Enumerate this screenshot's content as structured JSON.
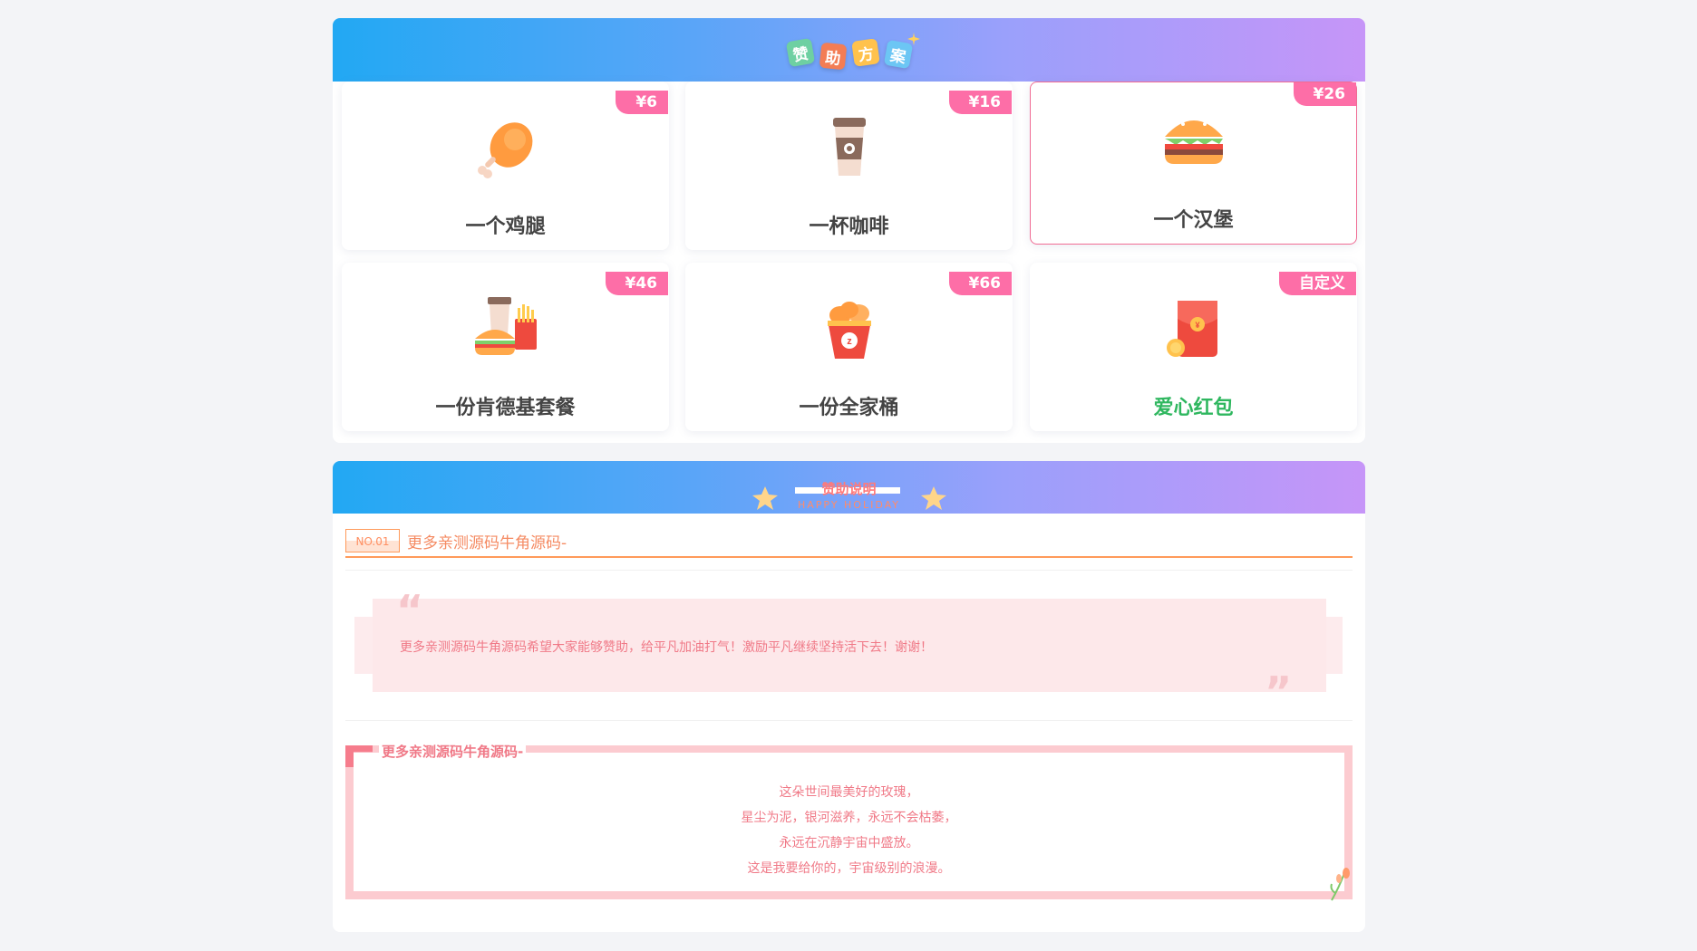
{
  "sponsor": {
    "title_chars": [
      "赞",
      "助",
      "方",
      "案"
    ],
    "options": [
      {
        "price": "¥6",
        "name": "一个鸡腿",
        "icon": "drumstick-icon"
      },
      {
        "price": "¥16",
        "name": "一杯咖啡",
        "icon": "coffee-cup-icon"
      },
      {
        "price": "¥26",
        "name": "一个汉堡",
        "icon": "burger-icon",
        "selected": true
      },
      {
        "price": "¥46",
        "name": "一份肯德基套餐",
        "icon": "combo-meal-icon"
      },
      {
        "price": "¥66",
        "name": "一份全家桶",
        "icon": "chicken-bucket-icon"
      },
      {
        "price": "自定义",
        "name": "爱心红包",
        "icon": "red-envelope-icon"
      }
    ]
  },
  "description": {
    "title": "赞助说明",
    "subtitle": "HAPPY HOLIDAY",
    "section_no": "NO.01",
    "section_title": "更多亲测源码牛角源码-",
    "quote_text": "更多亲测源码牛角源码希望大家能够赞助，给平凡加油打气！激励平凡继续坚持活下去！谢谢！",
    "poem_title": "更多亲测源码牛角源码-",
    "poem_lines": [
      "这朵世间最美好的玫瑰，",
      "星尘为泥，银河滋养，永远不会枯萎，",
      "永远在沉静宇宙中盛放。",
      "这是我要给你的，宇宙级别的浪漫。"
    ]
  },
  "colors": {
    "banner_start": "#22a8f3",
    "banner_end": "#c695f8",
    "price_tag": "#fd6ea7",
    "selected_border": "#f06c94",
    "accent_green": "#2fb75f",
    "accent_pink": "#f07987",
    "accent_orange": "#ff9a5a"
  }
}
